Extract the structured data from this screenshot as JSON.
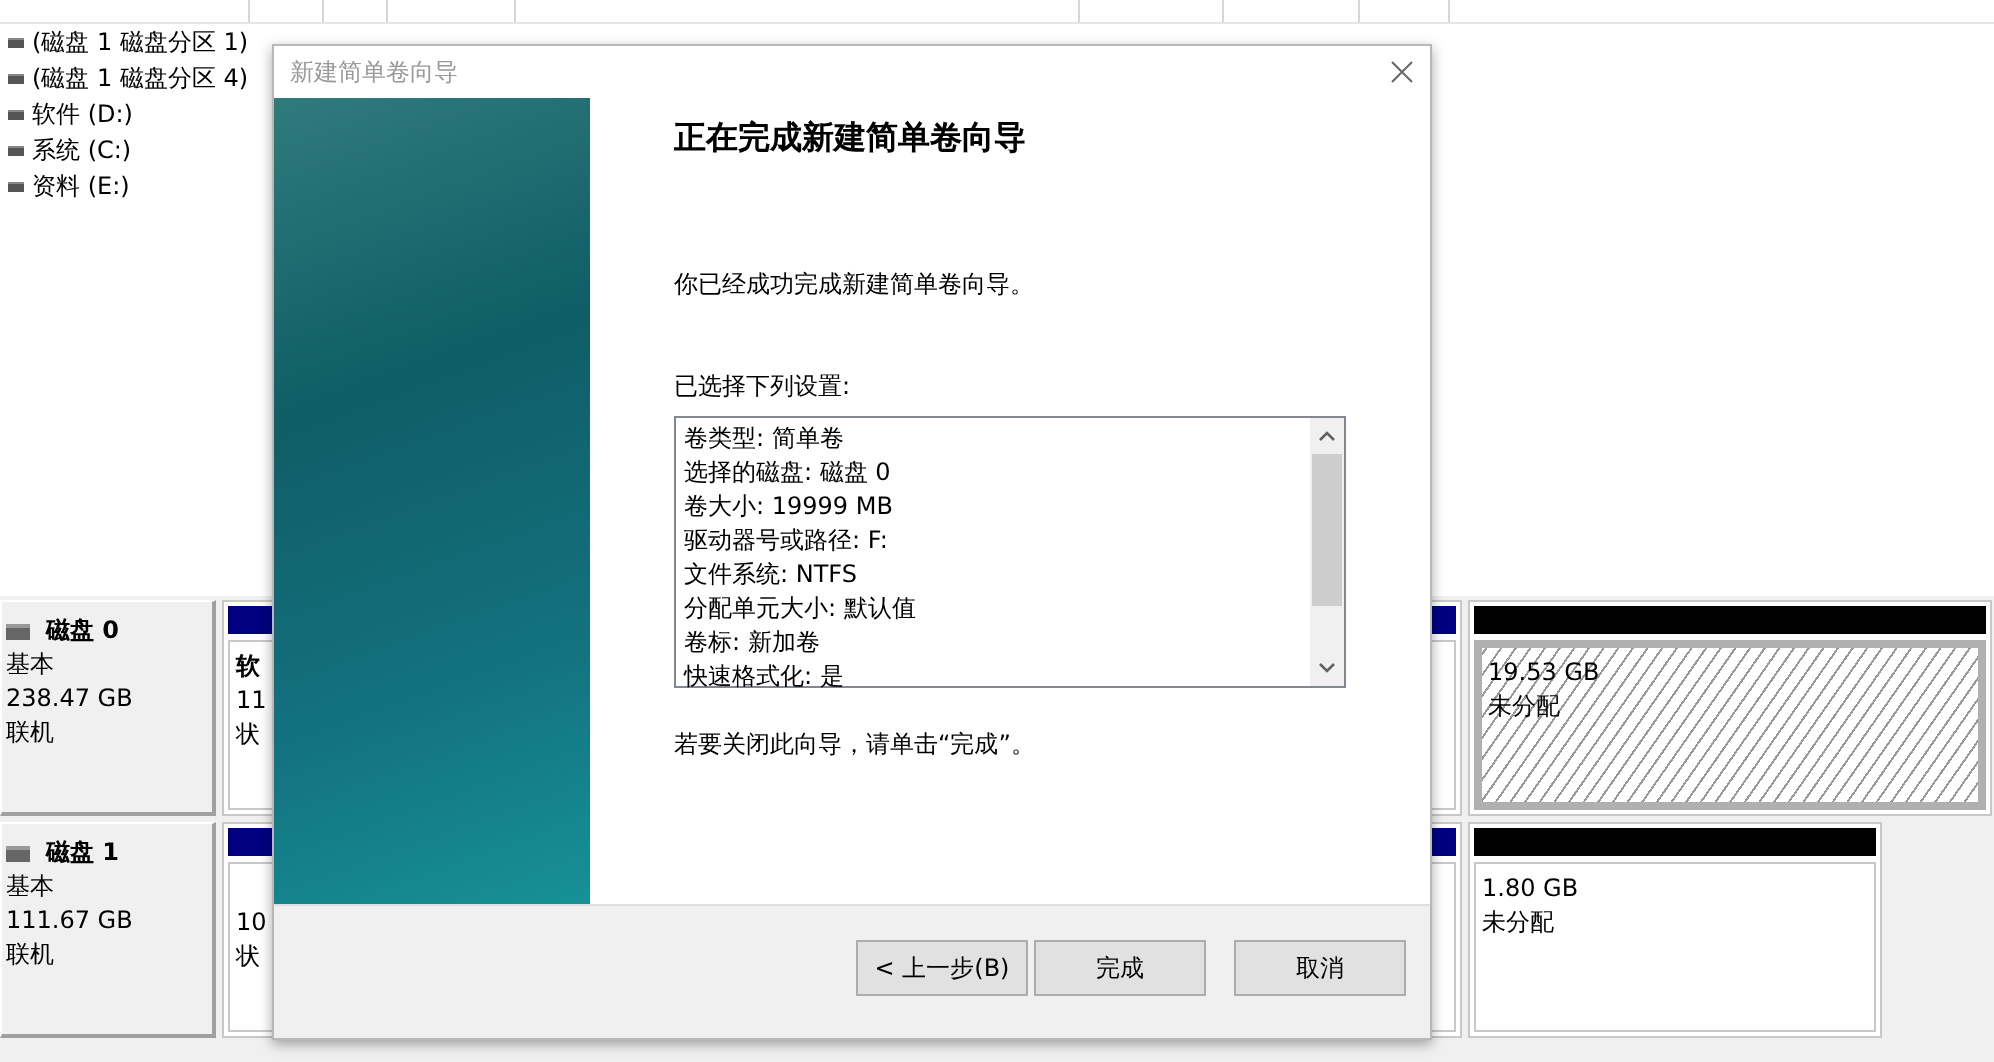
{
  "volume_list": {
    "rows": [
      {
        "cells": [
          "(磁盘 1 磁盘分区 1)"
        ]
      },
      {
        "cells": [
          "(磁盘 1 磁盘分区 4)"
        ]
      },
      {
        "cells": [
          "软件 (D:)"
        ]
      },
      {
        "cells": [
          "系统 (C:)"
        ]
      },
      {
        "cells": [
          "资料 (E:)"
        ]
      }
    ]
  },
  "disks": [
    {
      "name": "磁盘 0",
      "type": "基本",
      "size": "238.47 GB",
      "status": "联机",
      "partitions": [
        {
          "kind": "primary",
          "selected": false,
          "title": "软",
          "lines": [
            "11",
            "状"
          ]
        },
        {
          "kind": "primary",
          "selected": false
        },
        {
          "kind": "unallocated",
          "selected": true,
          "lines": [
            "19.53 GB",
            "未分配"
          ]
        }
      ]
    },
    {
      "name": "磁盘 1",
      "type": "基本",
      "size": "111.67 GB",
      "status": "联机",
      "partitions": [
        {
          "kind": "primary",
          "selected": false,
          "lines": [
            "10",
            "状"
          ]
        },
        {
          "kind": "primary",
          "selected": false
        },
        {
          "kind": "unallocated",
          "selected": false,
          "lines": [
            "1.80 GB",
            "未分配"
          ]
        }
      ]
    }
  ],
  "dialog": {
    "title": "新建简单卷向导",
    "heading": "正在完成新建简单卷向导",
    "intro": "你已经成功完成新建简单卷向导。",
    "settings_label": "已选择下列设置:",
    "settings": [
      "卷类型: 简单卷",
      "选择的磁盘: 磁盘 0",
      "卷大小: 19999 MB",
      "驱动器号或路径: F:",
      "文件系统: NTFS",
      "分配单元大小: 默认值",
      "卷标: 新加卷",
      "快速格式化: 是"
    ],
    "closing": "若要关闭此向导，请单击“完成”。",
    "buttons": [
      {
        "label": "< 上一步(B)",
        "disabled": false
      },
      {
        "label": "完成",
        "disabled": false
      },
      {
        "label": "取消",
        "disabled": false
      }
    ]
  }
}
